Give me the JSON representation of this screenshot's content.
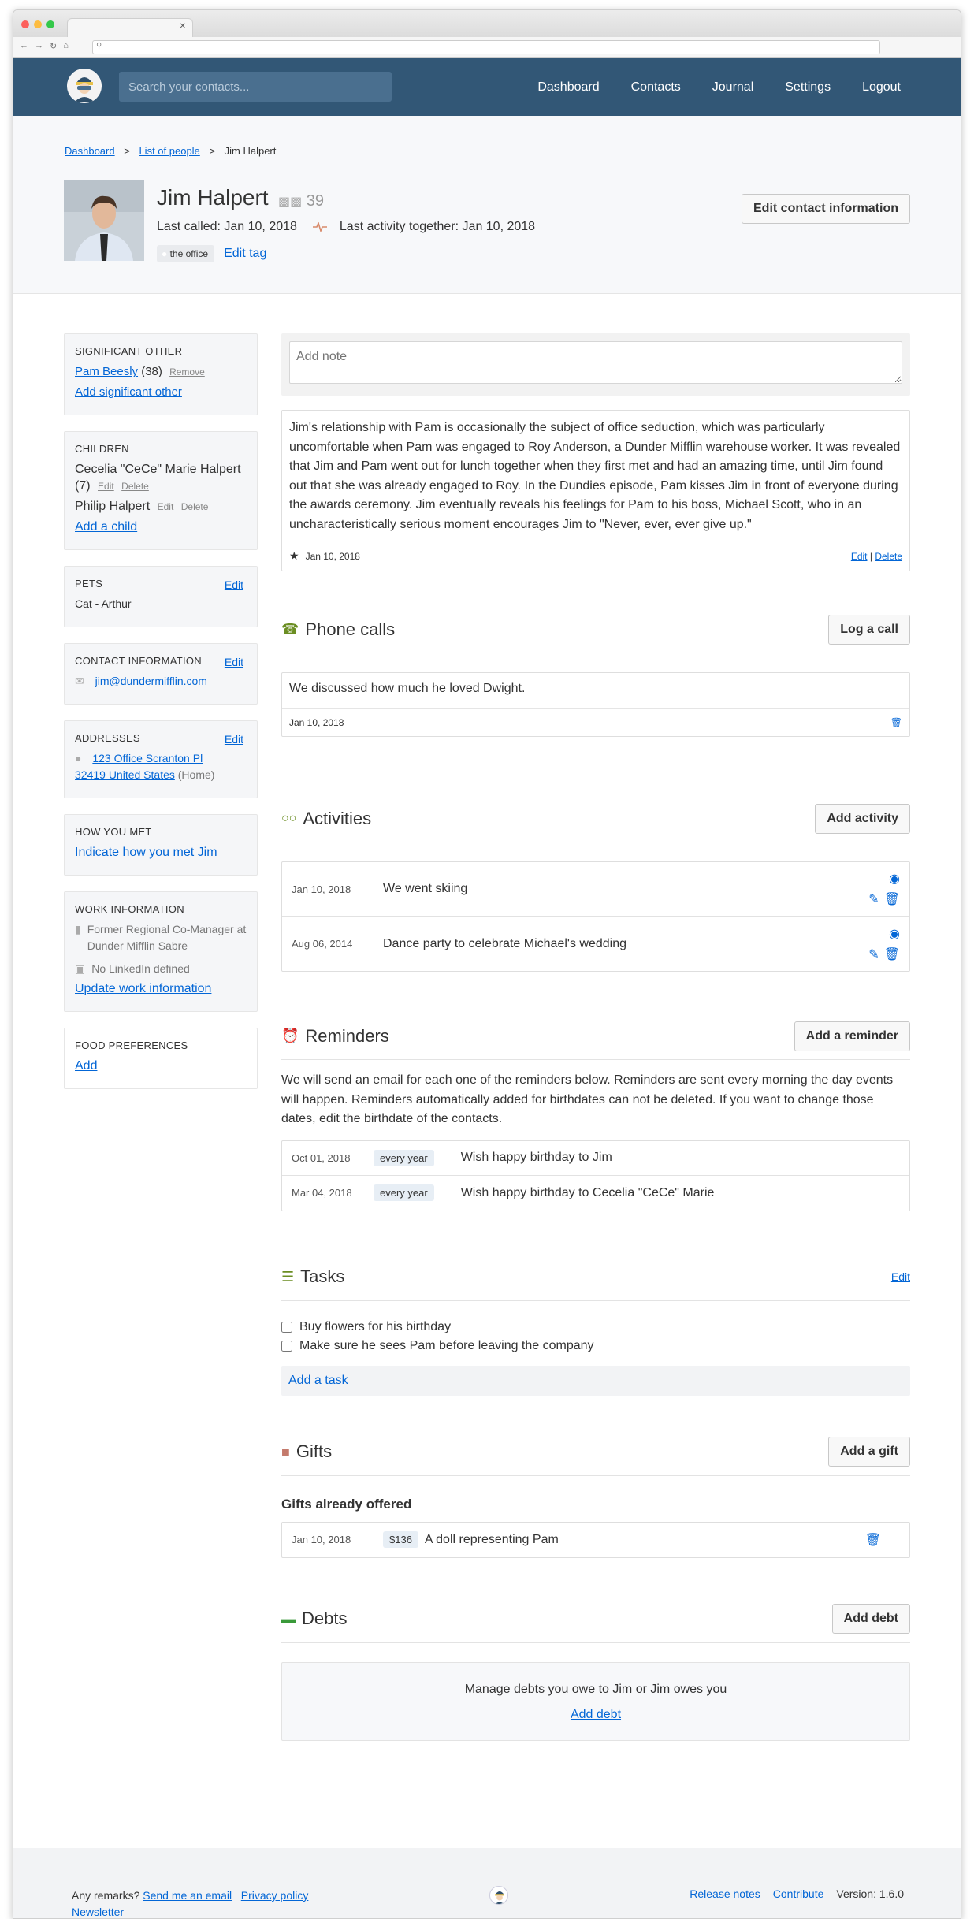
{
  "header": {
    "search_placeholder": "Search your contacts...",
    "nav": [
      "Dashboard",
      "Contacts",
      "Journal",
      "Settings",
      "Logout"
    ]
  },
  "breadcrumb": {
    "dashboard": "Dashboard",
    "list": "List of people",
    "current": "Jim Halpert",
    "sep": ">"
  },
  "profile": {
    "name": "Jim Halpert",
    "age": "39",
    "last_called": "Last called: Jan 10, 2018",
    "last_activity": "Last activity together: Jan 10, 2018",
    "tag": "the office",
    "edit_tag": "Edit tag",
    "edit_contact": "Edit contact information"
  },
  "sidebar": {
    "significant_other": {
      "title": "SIGNIFICANT OTHER",
      "name": "Pam Beesly",
      "age": "(38)",
      "remove": "Remove",
      "add": "Add significant other"
    },
    "children": {
      "title": "CHILDREN",
      "items": [
        {
          "name": "Cecelia \"CeCe\" Marie Halpert (7)",
          "edit": "Edit",
          "delete": "Delete"
        },
        {
          "name": "Philip Halpert",
          "edit": "Edit",
          "delete": "Delete"
        }
      ],
      "add": "Add a child"
    },
    "pets": {
      "title": "PETS",
      "edit": "Edit",
      "value": "Cat - Arthur"
    },
    "contact": {
      "title": "CONTACT INFORMATION",
      "edit": "Edit",
      "email": "jim@dundermifflin.com"
    },
    "addresses": {
      "title": "ADDRESSES",
      "edit": "Edit",
      "line1": "123 Office Scranton Pl",
      "line2": "32419 United States",
      "type": "(Home)"
    },
    "how_met": {
      "title": "HOW YOU MET",
      "link": "Indicate how you met Jim"
    },
    "work": {
      "title": "WORK INFORMATION",
      "job": "Former Regional Co-Manager at Dunder Mifflin Sabre",
      "linkedin": "No LinkedIn defined",
      "update": "Update work information"
    },
    "food": {
      "title": "FOOD PREFERENCES",
      "add": "Add"
    }
  },
  "note": {
    "placeholder": "Add note",
    "text": "Jim's relationship with Pam is occasionally the subject of office seduction, which was particularly uncomfortable when Pam was engaged to Roy Anderson, a Dunder Mifflin warehouse worker. It was revealed that Jim and Pam went out for lunch together when they first met and had an amazing time, until Jim found out that she was already engaged to Roy. In the Dundies episode, Pam kisses Jim in front of everyone during the awards ceremony. Jim eventually reveals his feelings for Pam to his boss, Michael Scott, who in an uncharacteristically serious moment encourages Jim to \"Never, ever, ever give up.\"",
    "date": "Jan 10, 2018",
    "edit": "Edit",
    "sep": "|",
    "delete": "Delete"
  },
  "calls": {
    "title": "Phone calls",
    "button": "Log a call",
    "text": "We discussed how much he loved Dwight.",
    "date": "Jan 10, 2018"
  },
  "activities": {
    "title": "Activities",
    "button": "Add activity",
    "items": [
      {
        "date": "Jan 10, 2018",
        "text": "We went skiing"
      },
      {
        "date": "Aug 06, 2014",
        "text": "Dance party to celebrate Michael's wedding"
      }
    ]
  },
  "reminders": {
    "title": "Reminders",
    "button": "Add a reminder",
    "intro": "We will send an email for each one of the reminders below. Reminders are sent every morning the day events will happen. Reminders automatically added for birthdates can not be deleted. If you want to change those dates, edit the birthdate of the contacts.",
    "items": [
      {
        "date": "Oct 01, 2018",
        "freq": "every year",
        "text": "Wish happy birthday to Jim"
      },
      {
        "date": "Mar 04, 2018",
        "freq": "every year",
        "text": "Wish happy birthday to Cecelia \"CeCe\" Marie"
      }
    ]
  },
  "tasks": {
    "title": "Tasks",
    "edit": "Edit",
    "items": [
      "Buy flowers for his birthday",
      "Make sure he sees Pam before leaving the company"
    ],
    "add": "Add a task"
  },
  "gifts": {
    "title": "Gifts",
    "button": "Add a gift",
    "subtitle": "Gifts already offered",
    "items": [
      {
        "date": "Jan 10, 2018",
        "amount": "$136",
        "text": "A doll representing Pam"
      }
    ]
  },
  "debts": {
    "title": "Debts",
    "button": "Add debt",
    "message": "Manage debts you owe to Jim or Jim owes you",
    "link": "Add debt"
  },
  "footer": {
    "remarks": "Any remarks?",
    "email": "Send me an email",
    "privacy": "Privacy policy",
    "newsletter": "Newsletter",
    "release": "Release notes",
    "contribute": "Contribute",
    "version": "Version: 1.6.0"
  },
  "colors": {
    "header": "#325776",
    "link": "#0366d6",
    "accent_red": "#e0453c"
  }
}
